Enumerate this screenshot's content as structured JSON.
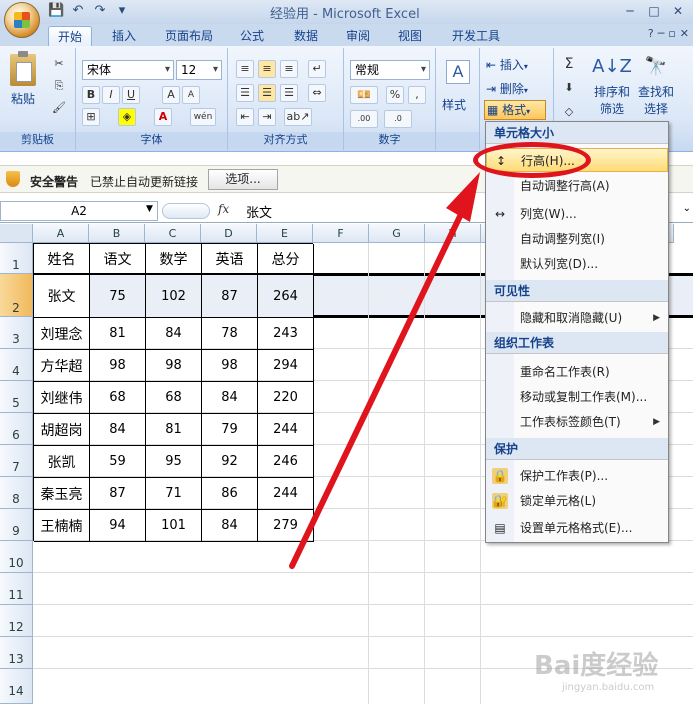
{
  "app": {
    "title": "经验用 - Microsoft Excel"
  },
  "tabs": [
    "开始",
    "插入",
    "页面布局",
    "公式",
    "数据",
    "审阅",
    "视图",
    "开发工具"
  ],
  "ribbon": {
    "clipboard": {
      "label": "剪贴板",
      "paste": "粘贴"
    },
    "font": {
      "label": "字体",
      "name": "宋体",
      "size": "12"
    },
    "alignment": {
      "label": "对齐方式"
    },
    "number": {
      "label": "数字",
      "format": "常规"
    },
    "style": {
      "label": "样式"
    },
    "cells": {
      "insert": "插入",
      "delete": "删除",
      "format": "格式"
    },
    "editing": {
      "sort": "排序和",
      "sort2": "筛选",
      "find": "查找和",
      "find2": "选择"
    }
  },
  "security": {
    "title": "安全警告",
    "message": "已禁止自动更新链接",
    "options": "选项..."
  },
  "formula": {
    "name_box": "A2",
    "fx": "fx",
    "value": "张文"
  },
  "columns": [
    "A",
    "B",
    "C",
    "D",
    "E",
    "F",
    "G",
    "H",
    "L"
  ],
  "rows": [
    "1",
    "2",
    "3",
    "4",
    "5",
    "6",
    "7",
    "8",
    "9",
    "10",
    "11",
    "12",
    "13",
    "14"
  ],
  "table": {
    "headers": [
      "姓名",
      "语文",
      "数学",
      "英语",
      "总分"
    ],
    "data": [
      [
        "张文",
        "75",
        "102",
        "87",
        "264"
      ],
      [
        "刘理念",
        "81",
        "84",
        "78",
        "243"
      ],
      [
        "方华超",
        "98",
        "98",
        "98",
        "294"
      ],
      [
        "刘继伟",
        "68",
        "68",
        "84",
        "220"
      ],
      [
        "胡超岗",
        "84",
        "81",
        "79",
        "244"
      ],
      [
        "张凯",
        "59",
        "95",
        "92",
        "246"
      ],
      [
        "秦玉亮",
        "87",
        "71",
        "86",
        "244"
      ],
      [
        "王楠楠",
        "94",
        "101",
        "84",
        "279"
      ]
    ]
  },
  "menu": {
    "section_size": "单元格大小",
    "row_height": "行高(H)...",
    "autofit_row": "自动调整行高(A)",
    "col_width": "列宽(W)...",
    "autofit_col": "自动调整列宽(I)",
    "default_width": "默认列宽(D)...",
    "section_visibility": "可见性",
    "hide_unhide": "隐藏和取消隐藏(U)",
    "section_organize": "组织工作表",
    "rename": "重命名工作表(R)",
    "move_copy": "移动或复制工作表(M)...",
    "tab_color": "工作表标签颜色(T)",
    "section_protect": "保护",
    "protect_sheet": "保护工作表(P)...",
    "lock_cell": "锁定单元格(L)",
    "format_cells": "设置单元格格式(E)..."
  },
  "watermark": {
    "brand": "Bai度经验",
    "url": "jingyan.baidu.com"
  }
}
